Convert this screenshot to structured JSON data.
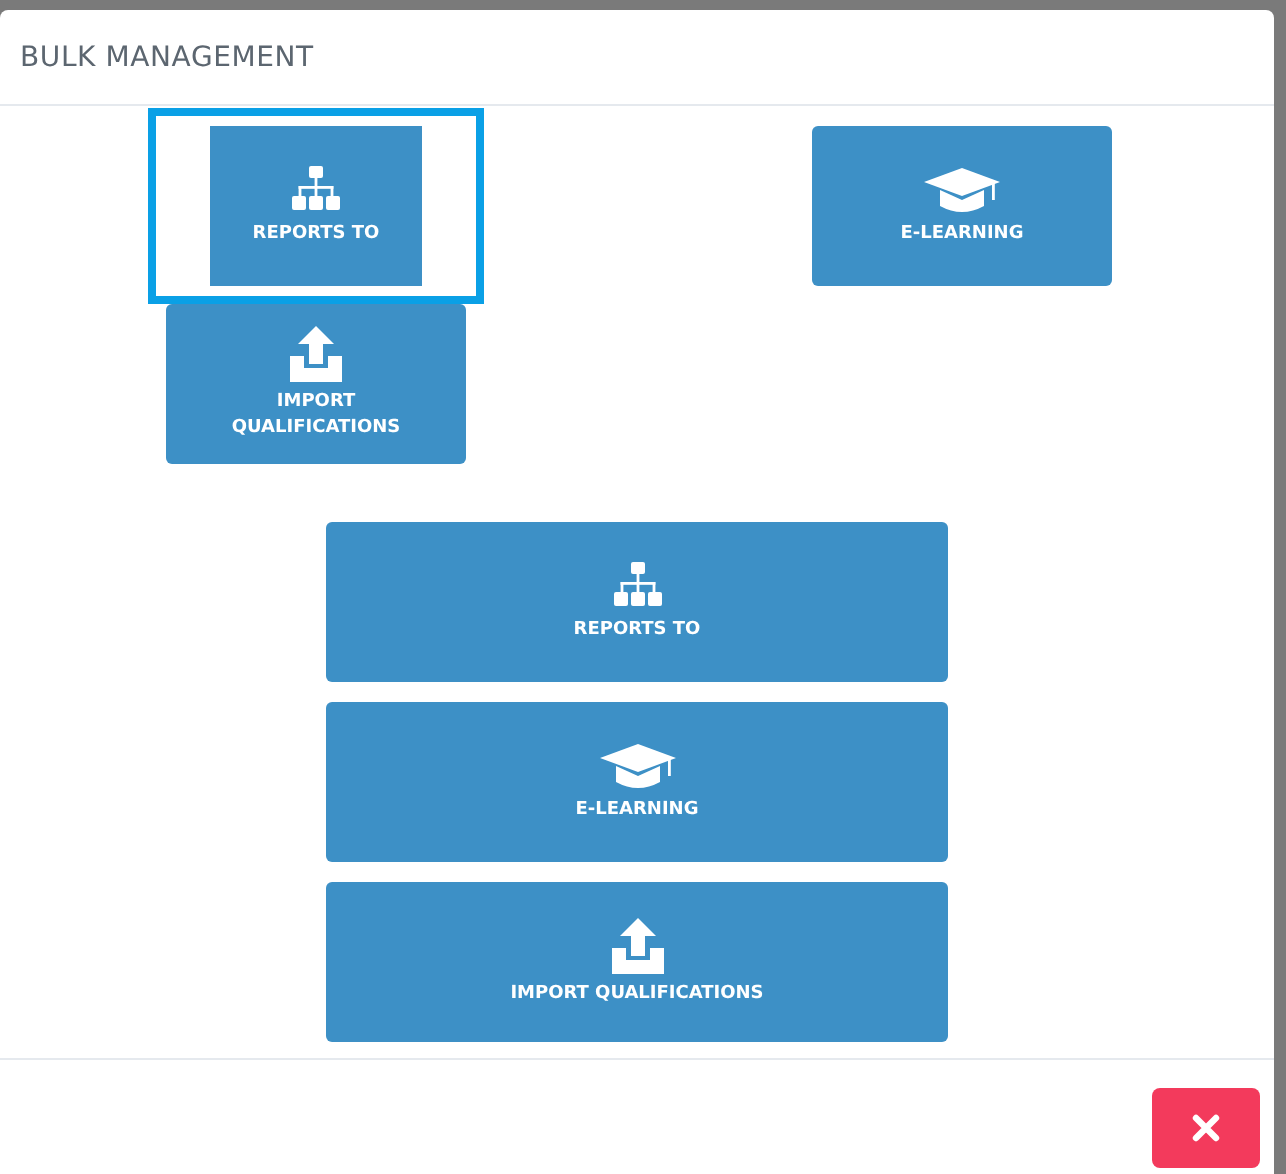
{
  "dialog": {
    "title": "BULK MANAGEMENT"
  },
  "tiles": [
    {
      "label": "REPORTS TO",
      "kind": "org",
      "selected": true
    },
    {
      "label": "E-LEARNING",
      "kind": "cap",
      "selected": false
    },
    {
      "label": "IMPORT QUALIFICATIONS",
      "kind": "upload",
      "selected": false
    }
  ],
  "wide_tiles": [
    {
      "label": "REPORTS TO",
      "kind": "org"
    },
    {
      "label": "E-LEARNING",
      "kind": "cap"
    },
    {
      "label": "IMPORT QUALIFICATIONS",
      "kind": "upload"
    }
  ],
  "footer": {
    "close_button": {
      "kind": "close"
    }
  }
}
